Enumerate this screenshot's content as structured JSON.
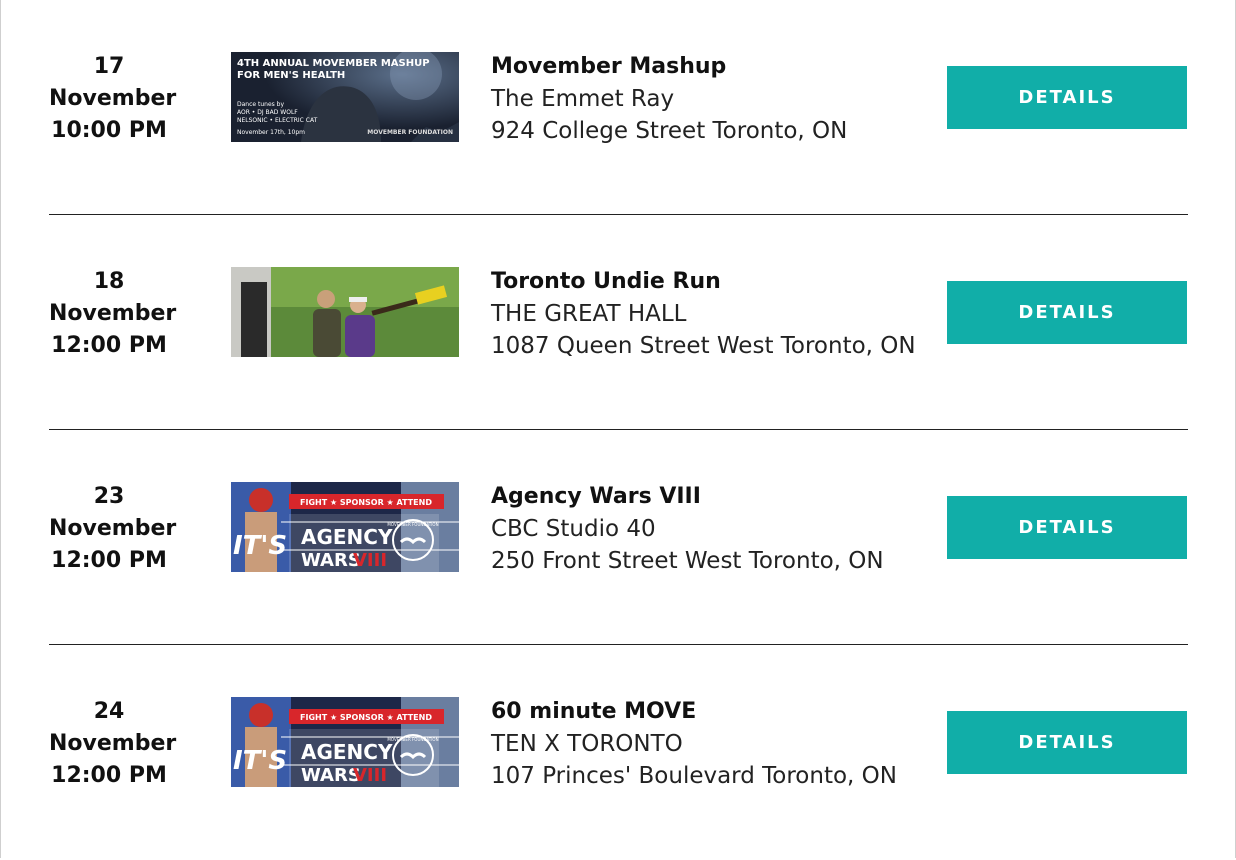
{
  "events": [
    {
      "day": "17",
      "month": "November",
      "time": "10:00 PM",
      "image_alt": "Movember Mashup poster",
      "image_text": {
        "line1": "4TH ANNUAL MOVEMBER MASHUP",
        "line2": "FOR MEN'S HEALTH",
        "line3": "Dance tunes by",
        "line4": "AOR • DJ BAD WOLF",
        "line5": "NELSONIC • ELECTRIC CAT",
        "line6": "November 17th, 10pm",
        "logo": "MOVEMBER FOUNDATION"
      },
      "title": "Movember Mashup",
      "venue": "The Emmet Ray",
      "address": "924 College Street Toronto, ON",
      "button": "DETAILS"
    },
    {
      "day": "18",
      "month": "November",
      "time": "12:00 PM",
      "image_alt": "Two people standing outside, one holding a yellow broom",
      "title": "Toronto Undie Run",
      "venue": "THE GREAT HALL",
      "address": "1087 Queen Street West Toronto, ON",
      "button": "DETAILS"
    },
    {
      "day": "23",
      "month": "November",
      "time": "12:00 PM",
      "image_alt": "Agency Wars VIII boxing poster",
      "image_text": {
        "banner": "FIGHT ★ SPONSOR ★ ATTEND",
        "left": "IT'S",
        "title1": "AGENCY",
        "title2": "WARS",
        "title3": "VIII",
        "logo": "MOVEMBER FOUNDATION"
      },
      "title": "Agency Wars VIII",
      "venue": "CBC Studio 40",
      "address": "250 Front Street West Toronto, ON",
      "button": "DETAILS"
    },
    {
      "day": "24",
      "month": "November",
      "time": "12:00 PM",
      "image_alt": "Agency Wars VIII boxing poster",
      "image_text": {
        "banner": "FIGHT ★ SPONSOR ★ ATTEND",
        "left": "IT'S",
        "title1": "AGENCY",
        "title2": "WARS",
        "title3": "VIII",
        "logo": "MOVEMBER FOUNDATION"
      },
      "title": "60 minute MOVE",
      "venue": "TEN X TORONTO",
      "address": "107 Princes' Boulevard Toronto, ON",
      "button": "DETAILS"
    }
  ],
  "colors": {
    "button_bg": "#11aea8",
    "button_text": "#ffffff",
    "divider": "#222222"
  }
}
